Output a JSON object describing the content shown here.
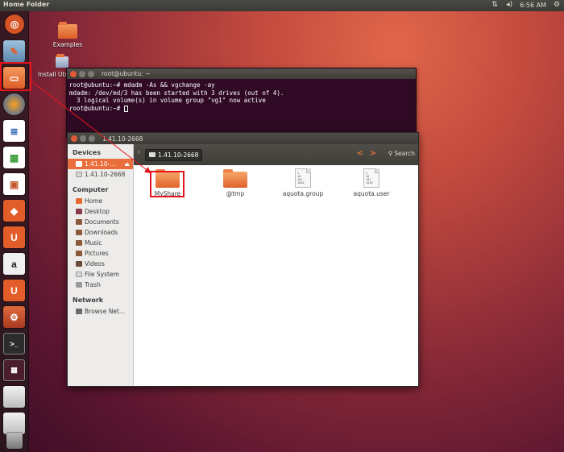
{
  "top_panel": {
    "title": "Home Folder",
    "clock": "6:56 AM",
    "icons": [
      "network-arrows-icon",
      "volume-icon",
      "gear-icon"
    ]
  },
  "launcher": {
    "items": [
      {
        "name": "dash-home",
        "icon": "ubuntu-logo-icon",
        "color": "#d45223"
      },
      {
        "name": "ubuntu-software",
        "icon": "software-icon",
        "color": "#7fa8c9"
      },
      {
        "name": "home-folder",
        "icon": "folder-icon",
        "color": "#e46a32"
      },
      {
        "name": "firefox",
        "icon": "firefox-icon",
        "color": "#2a5fb5"
      },
      {
        "name": "libreoffice-writer",
        "icon": "writer-icon",
        "color": "#3a6fbd"
      },
      {
        "name": "libreoffice-calc",
        "icon": "calc-icon",
        "color": "#3d9a3b"
      },
      {
        "name": "libreoffice-impress",
        "icon": "impress-icon",
        "color": "#c2562a"
      },
      {
        "name": "software-center",
        "icon": "bag-icon",
        "color": "#e35d2a"
      },
      {
        "name": "ubuntu-one",
        "icon": "ubuntu-one-icon",
        "color": "#e35d2a"
      },
      {
        "name": "amazon",
        "icon": "amazon-icon",
        "color": "#e9e9e9"
      },
      {
        "name": "ubuntu-one-music",
        "icon": "ubuntu-one-icon",
        "color": "#e35d2a"
      },
      {
        "name": "system-settings",
        "icon": "settings-icon",
        "color": "#c94b2b"
      },
      {
        "name": "terminal",
        "icon": "terminal-icon",
        "color": "#3a3a3a"
      },
      {
        "name": "workspace-switcher",
        "icon": "workspace-icon",
        "color": "#6b2c3a"
      },
      {
        "name": "drive-1",
        "icon": "drive-icon",
        "color": "#cfcfcf"
      },
      {
        "name": "drive-2",
        "icon": "drive-icon",
        "color": "#cfcfcf"
      },
      {
        "name": "trash",
        "icon": "trash-icon",
        "color": "#9a9a9a"
      }
    ]
  },
  "desktop": {
    "icons": [
      {
        "label": "Examples"
      },
      {
        "label": "Install Ub"
      }
    ]
  },
  "terminal": {
    "title": "root@ubuntu: ~",
    "lines": [
      "root@ubuntu:~# mdadm -As && vgchange -ay",
      "mdadm: /dev/md/3 has been started with 3 drives (out of 4).",
      "  3 logical volume(s) in volume group \"vg1\" now active",
      "root@ubuntu:~# "
    ]
  },
  "file_manager": {
    "title": "1.41.10-2668",
    "path_button": "1.41.10-2668",
    "search_label": "Search",
    "sidebar": {
      "devices_heading": "Devices",
      "devices": [
        {
          "label": "1.41.10-...",
          "selected": true
        },
        {
          "label": "1.41.10-2668",
          "selected": false
        }
      ],
      "computer_heading": "Computer",
      "computer": [
        {
          "label": "Home",
          "icon": "home-icon"
        },
        {
          "label": "Desktop",
          "icon": "desktop-icon"
        },
        {
          "label": "Documents",
          "icon": "documents-icon"
        },
        {
          "label": "Downloads",
          "icon": "downloads-icon"
        },
        {
          "label": "Music",
          "icon": "music-icon"
        },
        {
          "label": "Pictures",
          "icon": "pictures-icon"
        },
        {
          "label": "Videos",
          "icon": "videos-icon"
        },
        {
          "label": "File System",
          "icon": "filesystem-icon"
        },
        {
          "label": "Trash",
          "icon": "trash-icon"
        }
      ],
      "network_heading": "Network",
      "network": [
        {
          "label": "Browse Net...",
          "icon": "network-icon"
        }
      ]
    },
    "items": [
      {
        "label": "MyShare",
        "type": "folder"
      },
      {
        "label": "@tmp",
        "type": "folder"
      },
      {
        "label": "aquota.group",
        "type": "file"
      },
      {
        "label": "aquota.user",
        "type": "file"
      }
    ],
    "doc_glyph_text": "1\n18\n101\n1010"
  },
  "colors": {
    "accent": "#e96e3c",
    "highlight": "#e8141b",
    "terminal_bg": "#300a24"
  }
}
